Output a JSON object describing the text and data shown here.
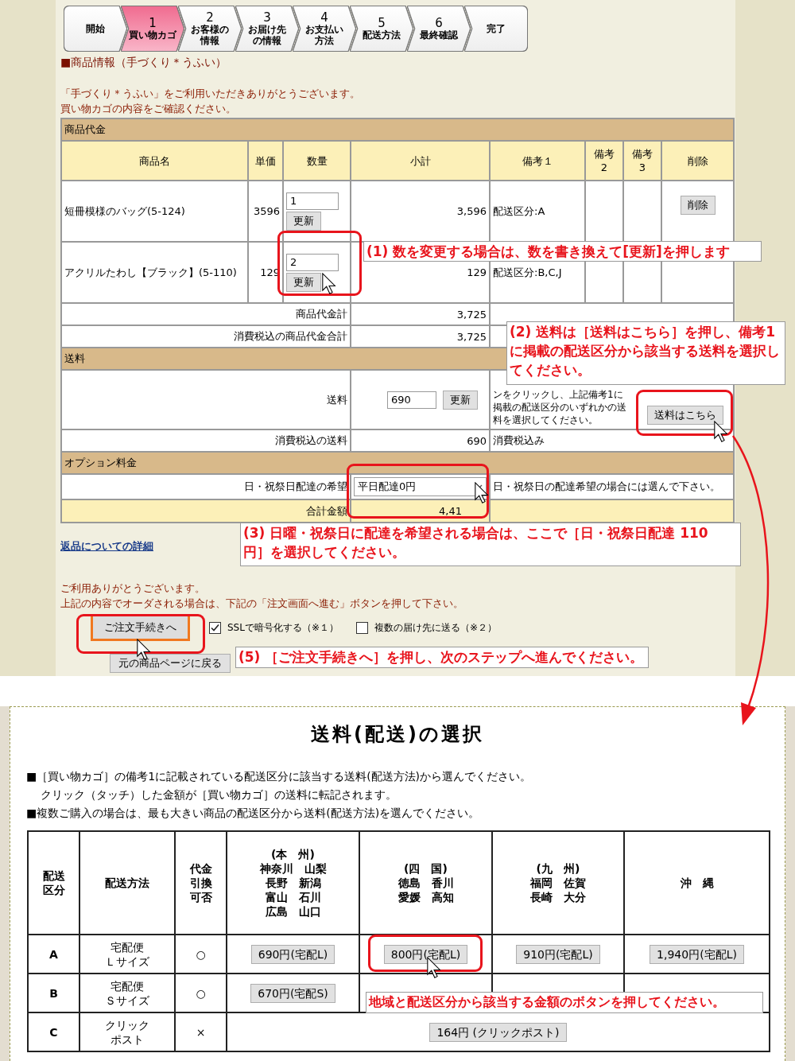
{
  "steps": [
    {
      "label": [
        "開始"
      ],
      "selected": false
    },
    {
      "number": "1",
      "label": [
        "買い物カゴ"
      ],
      "selected": true
    },
    {
      "number": "2",
      "label": [
        "お客様の",
        "情報"
      ],
      "selected": false
    },
    {
      "number": "3",
      "label": [
        "お届け先",
        "の情報"
      ],
      "selected": false
    },
    {
      "number": "4",
      "label": [
        "お支払い",
        "方法"
      ],
      "selected": false
    },
    {
      "number": "5",
      "label": [
        "配送方法"
      ],
      "selected": false
    },
    {
      "number": "6",
      "label": [
        "最終確認"
      ],
      "selected": false
    },
    {
      "label": [
        "完了"
      ],
      "selected": false
    }
  ],
  "section_title": "■商品情報（手づくり＊うふい）",
  "intro": [
    "「手づくり＊うふい」をご利用いただきありがとうございます。",
    "買い物カゴの内容をご確認ください。"
  ],
  "cart": {
    "section": "商品代金",
    "columns": [
      [
        "商品名"
      ],
      [
        "単価"
      ],
      [
        "数量"
      ],
      [
        "小計"
      ],
      [
        "備考１"
      ],
      [
        "備考",
        "2"
      ],
      [
        "備考",
        "3"
      ],
      [
        "削除"
      ]
    ],
    "items": [
      {
        "name": "短冊模様のバッグ(5-124)",
        "price": "3596",
        "quantity": "1",
        "update": "更新",
        "subtotal": "3,596",
        "note1": "配送区分:A",
        "delete": "削除"
      },
      {
        "name": "アクリルたわし【ブラック】(5-110)",
        "price": "129",
        "quantity": "2",
        "update": "更新",
        "subtotal": "129",
        "note1": "配送区分:B,C,J"
      }
    ],
    "totals": [
      {
        "label": "商品代金計",
        "value": "3,725"
      },
      {
        "label": "消費税込の商品代金合計",
        "value": "3,725"
      }
    ]
  },
  "shipping": {
    "section": "送料",
    "label": "送料",
    "value": "690",
    "update": "更新",
    "note": "ンをクリックし、上記備考1に掲載の配送区分のいずれかの送料を選択してください。",
    "rate_button": "送料はこちら",
    "tax_label": "消費税込の送料",
    "tax_value": "690",
    "tax_note": "消費税込み"
  },
  "options": {
    "section": "オプション料金",
    "label": "日・祝祭日配達の希望",
    "select": "平日配達0円",
    "note": "日・祝祭日の配達希望の場合には選んで下さい。",
    "total_label": "合計金額",
    "total_value": "4,41"
  },
  "return_link": "返品についての詳細",
  "thanks": [
    "ご利用ありがとうございます。",
    "上記の内容でオーダされる場合は、下記の「注文画面へ進む」ボタンを押して下さい。"
  ],
  "order_button": "ご注文手続きへ",
  "checkboxes": [
    {
      "label": "SSLで暗号化する（※１）",
      "checked": true
    },
    {
      "label": "複数の届け先に送る（※２）",
      "checked": false
    }
  ],
  "back_button": "元の商品ページに戻る",
  "rates": {
    "title": "送料(配送)の選択",
    "notes": [
      "■［買い物カゴ］の備考1に記載されている配送区分に該当する送料(配送方法)から選んでください。",
      "クリック（タッチ）した金額が［買い物カゴ］の送料に転記されます。",
      "■複数ご購入の場合は、最も大きい商品の配送区分から送料(配送方法)を選んでください。"
    ],
    "columns": [
      [
        "配送",
        "区分"
      ],
      [
        "配送方法"
      ],
      [
        "代金",
        "引換",
        "可否"
      ],
      [
        "(本　州)",
        "神奈川　山梨",
        "長野　新潟",
        "富山　石川",
        "広島　山口"
      ],
      [
        "(四　国)",
        "徳島　香川",
        "愛媛　高知"
      ],
      [
        "(九　州)",
        "福岡　佐賀",
        "長崎　大分"
      ],
      [
        "沖　縄"
      ]
    ],
    "rows": [
      {
        "code": "A",
        "method": [
          "宅配便",
          "Ｌサイズ"
        ],
        "cod": "○",
        "prices": [
          "690円(宅配L)",
          "800円(宅配L)",
          "910円(宅配L)",
          "1,940円(宅配L)"
        ]
      },
      {
        "code": "B",
        "method": [
          "宅配便",
          "Ｓサイズ"
        ],
        "cod": "○",
        "prices": [
          "670円(宅配S)"
        ]
      },
      {
        "code": "C",
        "method": [
          "クリック",
          "ポスト"
        ],
        "cod": "×",
        "prices": [
          "164円 (クリックポスト)"
        ]
      }
    ]
  },
  "annotations": [
    "(1) 数を変更する場合は、数を書き換えて[更新]を押します",
    "(2) 送料は［送料はこちら］を押し、備考1に掲載の配送区分から該当する送料を選択してください。",
    "(3) 日曜・祝祭日に配達を希望される場合は、ここで［日・祝祭日配達 110 円］を選択してください。",
    "(5) ［ご注文手続きへ］を押し、次のステップへ進んでください。",
    "地域と配送区分から該当する金額のボタンを押してください。"
  ]
}
